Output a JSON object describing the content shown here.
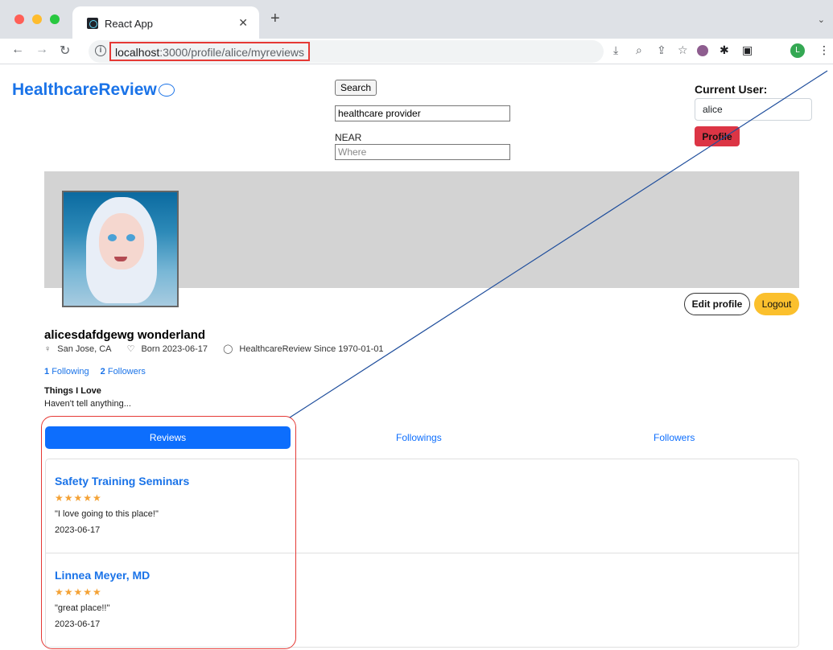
{
  "browser": {
    "tab_title": "React App",
    "url_host": "localhost",
    "url_path": ":3000/profile/alice/myreviews"
  },
  "header": {
    "brand": "HealthcareReview",
    "search_button": "Search",
    "search_value": "healthcare provider",
    "near_label": "NEAR",
    "near_placeholder": "Where",
    "current_user_label": "Current User:",
    "current_user_value": "alice",
    "profile_button": "Profile"
  },
  "profile": {
    "full_name": "alicesdafdgewg wonderland",
    "location": "San Jose, CA",
    "born": "Born 2023-06-17",
    "since": "HealthcareReview Since 1970-01-01",
    "following_count": "1",
    "following_label": "Following",
    "followers_count": "2",
    "followers_label": "Followers",
    "things_title": "Things I Love",
    "things_body": "Haven't tell anything...",
    "edit_button": "Edit profile",
    "logout_button": "Logout"
  },
  "tabs": {
    "reviews": "Reviews",
    "followings": "Followings",
    "followers": "Followers"
  },
  "reviews": [
    {
      "title": "Safety Training Seminars",
      "stars": "★★★★★",
      "rating": 5,
      "text": "\"I love going to this place!\"",
      "date": "2023-06-17"
    },
    {
      "title": "Linnea Meyer, MD",
      "stars": "★★★★★",
      "rating": 5,
      "text": "\"great place!!\"",
      "date": "2023-06-17"
    }
  ],
  "colors": {
    "brand": "#1a73e8",
    "primary": "#0d6efd",
    "danger": "#dc3545",
    "warning": "#fbc02d",
    "stars": "#f4a235",
    "annotation": "#e53935"
  }
}
